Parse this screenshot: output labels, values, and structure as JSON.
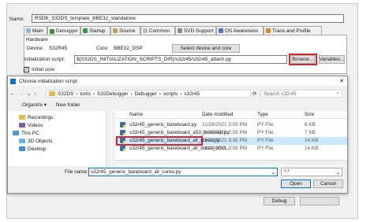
{
  "main": {
    "name_label": "Name:",
    "name_value": "RSDK_S32DS_template_BBE32_standalone",
    "tabs": [
      {
        "label": "Main"
      },
      {
        "label": "Debugger"
      },
      {
        "label": "Startup"
      },
      {
        "label": "Source"
      },
      {
        "label": "Common"
      },
      {
        "label": "SVD Support"
      },
      {
        "label": "OS Awareness"
      },
      {
        "label": "Trace and Profile"
      }
    ],
    "hardware_label": "Hardware",
    "device_label": "Device:",
    "device_value": "S32R45",
    "core_label": "Core:",
    "core_value": "BBE32_DSP",
    "select_device_button": "Select device and core",
    "init_script_label": "Initialization script:",
    "init_script_value": "${S32DS_INITIALIZATION_SCRIPTS_DIR}/s32r45/s32r45_attach.py",
    "browse_button": "Browse...",
    "variables_button": "Variables...",
    "initial_core_label": "Initial core",
    "debug_button": "Debug"
  },
  "dialog": {
    "title": "Choose initialization script",
    "close": "✕",
    "breadcrumb": [
      "S32DS",
      "tools",
      "S32Debugger",
      "Debugger",
      "scripts",
      "s32r45"
    ],
    "search_placeholder": "Search s32r45",
    "organize": "Organize ▾",
    "new_folder": "New folder",
    "nav_items": [
      "Recordings",
      "Videos",
      "This PC",
      "3D Objects",
      "Desktop"
    ],
    "columns": {
      "name": "Name",
      "date": "Date modified",
      "type": "Type",
      "size": "Size"
    },
    "files": [
      {
        "name": "s32r45_generic_bareboard.py",
        "date": "11/29/2021 3:05 PM",
        "type": "PY File",
        "size": "6 KB"
      },
      {
        "name": "s32r45_generic_bareboard_a53_lockstep.py",
        "date": "11/29/2021 3:05 PM",
        "type": "PY File",
        "size": "7 KB"
      },
      {
        "name": "s32r45_generic_bareboard_all_cores.py",
        "date": "11/29/2021 3:05 PM",
        "type": "PY File",
        "size": "14 KB"
      },
      {
        "name": "s32r45_generic_bareboard_all_cores_ddr3...",
        "date": "11/29/2021 3:05 PM",
        "type": "PY File",
        "size": "14 KB"
      }
    ],
    "filename_label": "File name:",
    "filename_value": "s32r45_generic_bareboard_all_cores.py",
    "filter_value": "*.*",
    "open_button": "Open",
    "cancel_button": "Cancel"
  },
  "colors": {
    "highlight": "#d9232d",
    "selection": "#cce8ff",
    "accent": "#0078d7"
  }
}
